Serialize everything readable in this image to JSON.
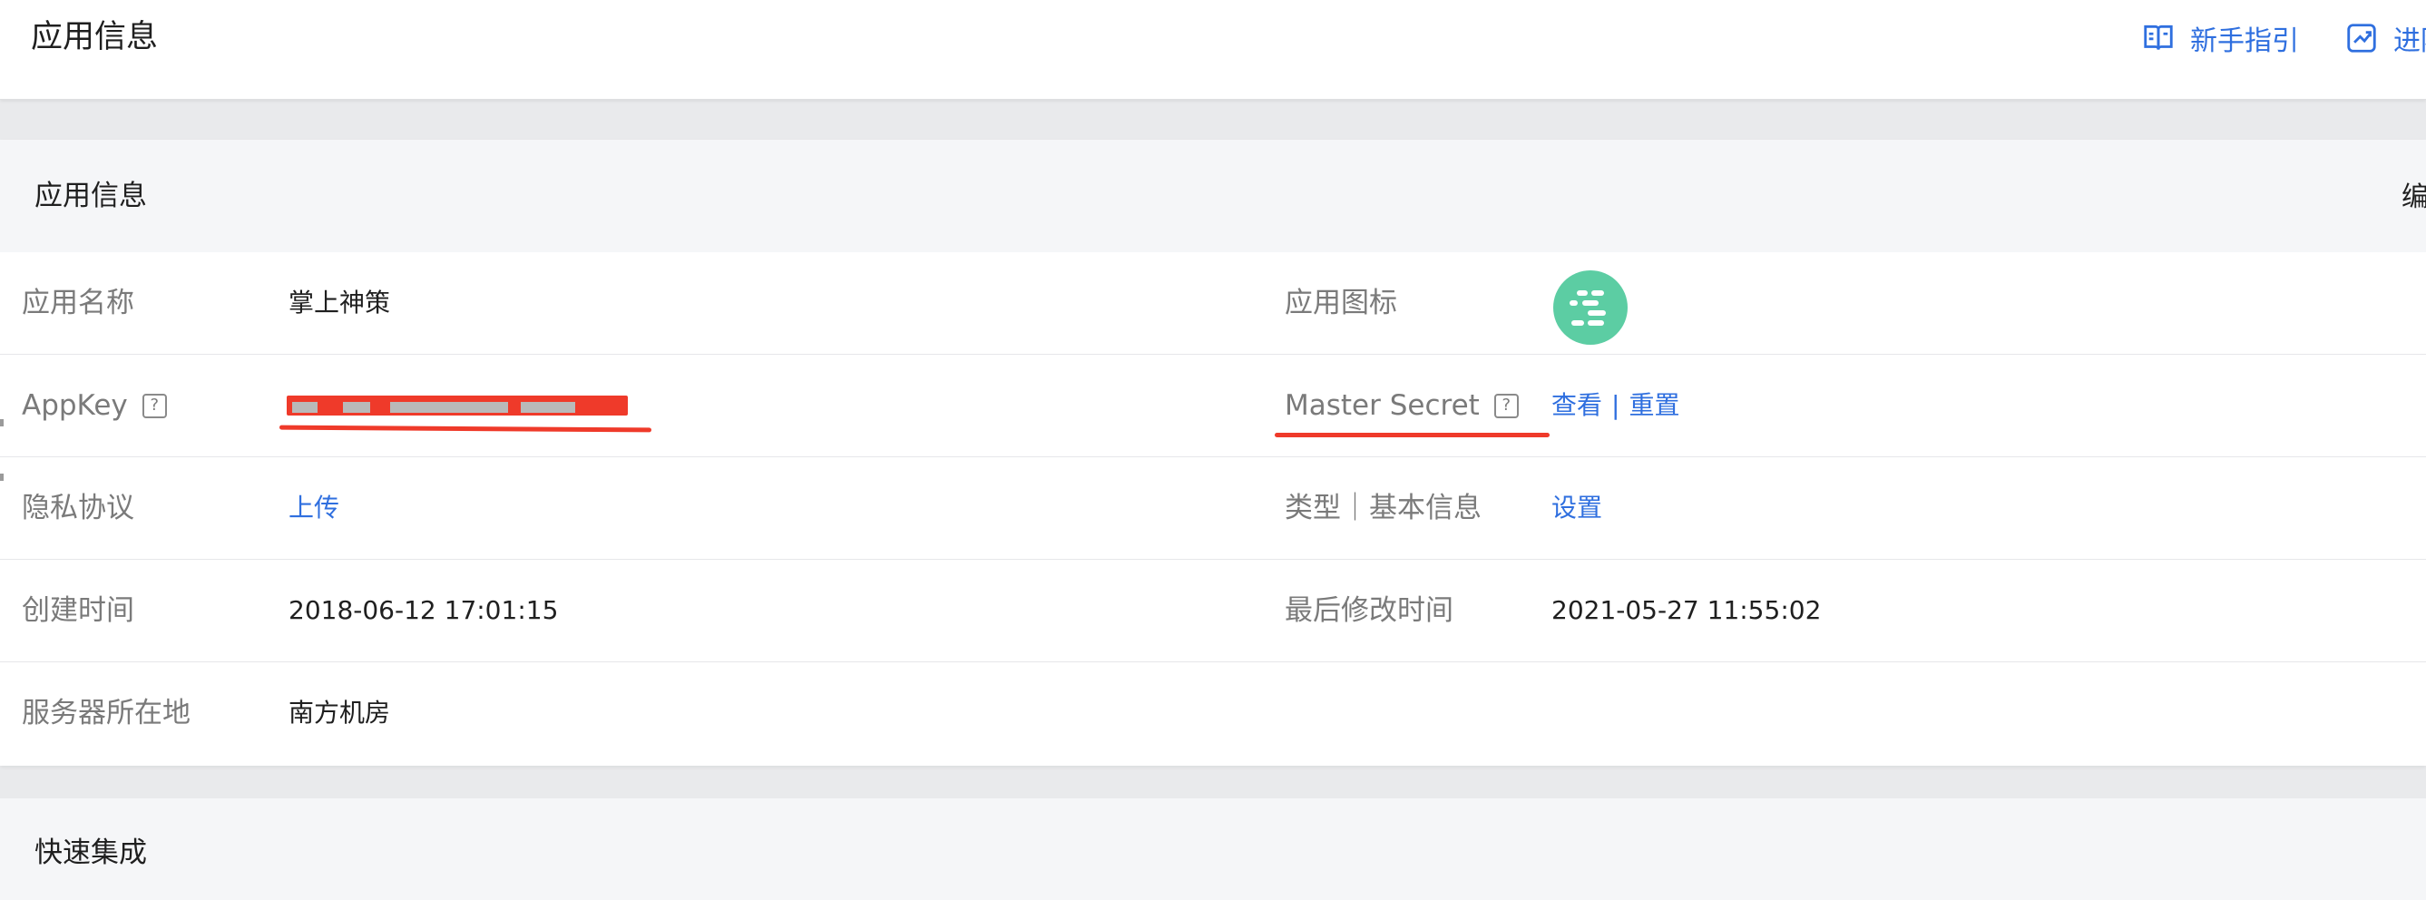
{
  "header": {
    "title": "应用信息",
    "links": [
      {
        "label": "新手指引",
        "icon": "book-icon"
      },
      {
        "label": "进阶",
        "icon": "trend-chart-icon"
      }
    ]
  },
  "app_info": {
    "title": "应用信息",
    "edit_label": "编",
    "rows": [
      {
        "left": {
          "label": "应用名称",
          "value": "掌上神策"
        },
        "right": {
          "label": "应用图标",
          "value_icon": "app-logo-icon"
        }
      },
      {
        "left": {
          "label": "AppKey",
          "help": "?",
          "value": ""
        },
        "right": {
          "label": "Master Secret",
          "help": "?",
          "actions": [
            "查看",
            "重置"
          ],
          "separator": "|"
        }
      },
      {
        "left": {
          "label": "隐私协议",
          "link": "上传"
        },
        "right": {
          "label": "类型｜基本信息",
          "link": "设置"
        }
      },
      {
        "left": {
          "label": "创建时间",
          "value": "2018-06-12 17:01:15"
        },
        "right": {
          "label": "最后修改时间",
          "value": "2021-05-27 11:55:02"
        }
      },
      {
        "left": {
          "label": "服务器所在地",
          "value": "南方机房"
        }
      }
    ]
  },
  "quick": {
    "title": "快速集成"
  },
  "colors": {
    "accent": "#2f6fdf",
    "redaction": "#ef3a2a",
    "app_icon": "#5ccda3",
    "page_bg": "#e9eaec",
    "header_bg": "#f5f6f8"
  }
}
